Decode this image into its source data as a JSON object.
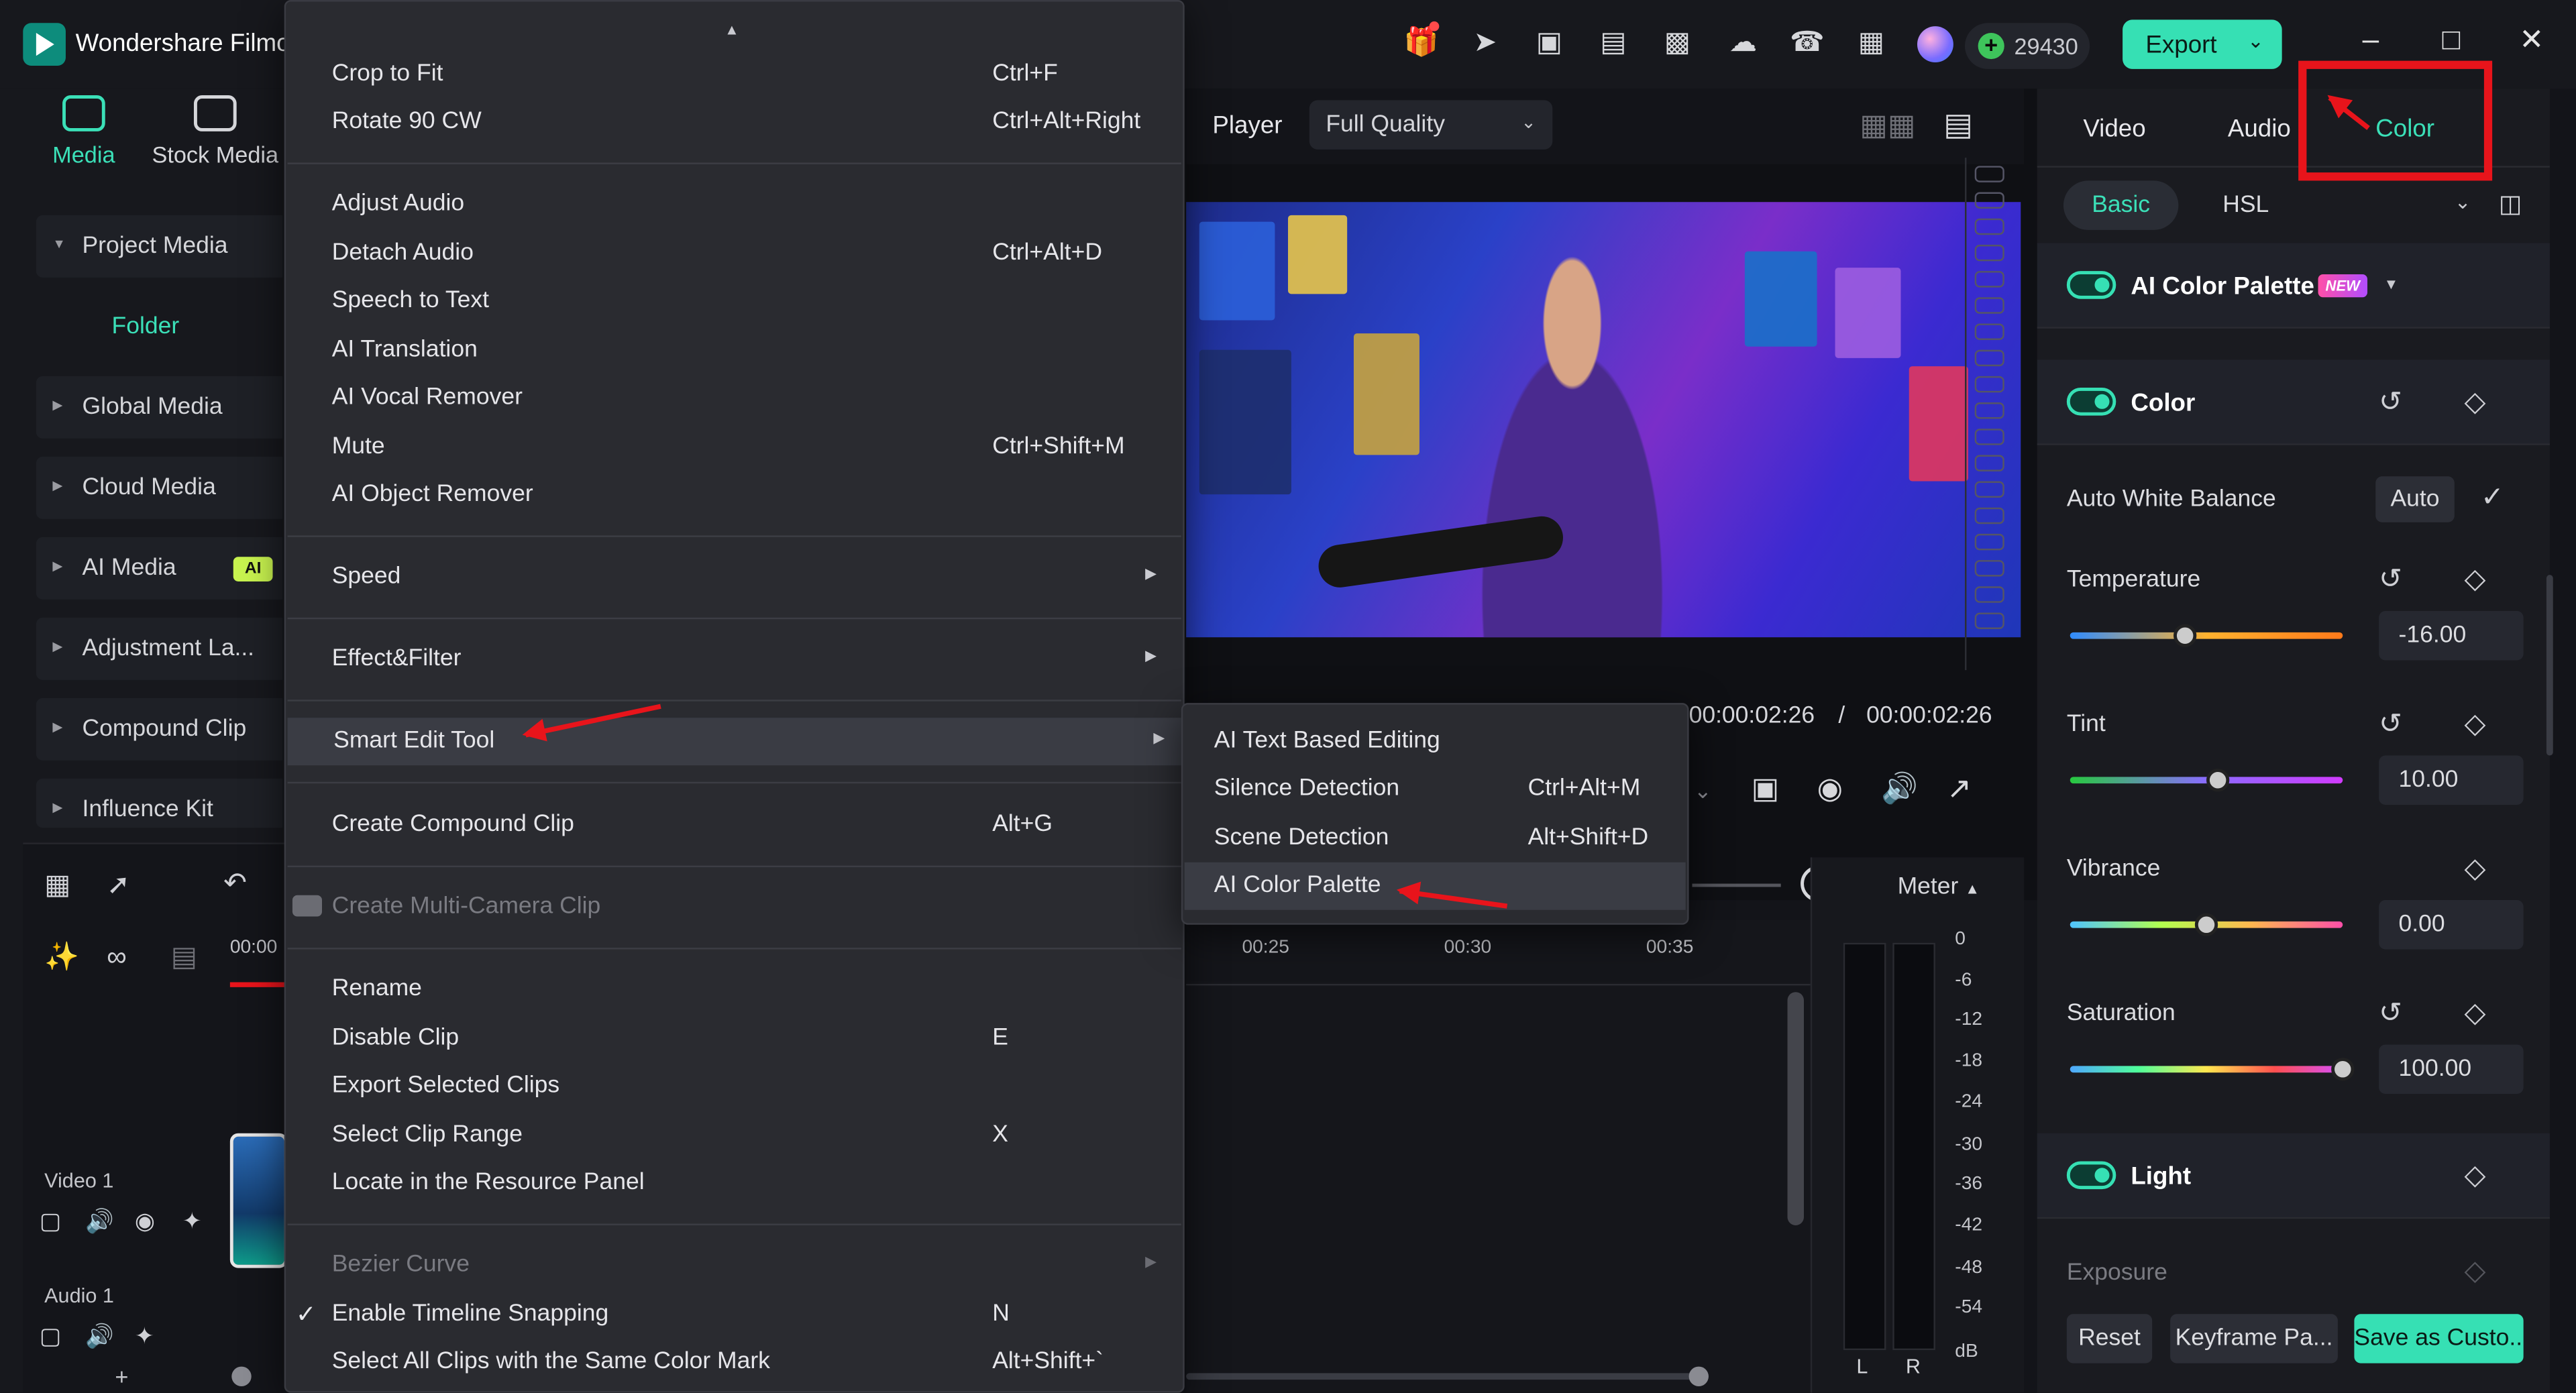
{
  "app": {
    "title": "Wondershare Filmora",
    "credits": "29430",
    "export_label": "Export"
  },
  "media_tabs": [
    {
      "label": "Media",
      "icon": "media-icon",
      "active": true
    },
    {
      "label": "Stock Media",
      "icon": "stock-media-icon",
      "active": false
    }
  ],
  "media_tree": {
    "project_media": "Project Media",
    "folder": "Folder",
    "items": [
      "Global Media",
      "Cloud Media",
      "AI Media",
      "Adjustment La...",
      "Compound Clip",
      "Influence Kit"
    ],
    "ai_badge": "AI"
  },
  "tracks": {
    "video": "Video 1",
    "audio": "Audio 1",
    "ruler_start": "00:00"
  },
  "player": {
    "label": "Player",
    "quality": "Full Quality",
    "current_time": "00:00:02:26",
    "separator": "/",
    "total_time": "00:00:02:26"
  },
  "timeline": {
    "ticks": [
      "00:25",
      "00:30",
      "00:35"
    ]
  },
  "meter": {
    "label": "Meter",
    "db_scale": [
      "0",
      "-6",
      "-12",
      "-18",
      "-24",
      "-30",
      "-36",
      "-42",
      "-48",
      "-54",
      "dB"
    ],
    "left": "L",
    "right": "R"
  },
  "context_menu": {
    "items": [
      {
        "label": "Crop to Fit",
        "shortcut": "Ctrl+F"
      },
      {
        "label": "Rotate 90 CW",
        "shortcut": "Ctrl+Alt+Right"
      },
      {
        "label": "Adjust Audio",
        "shortcut": ""
      },
      {
        "label": "Detach Audio",
        "shortcut": "Ctrl+Alt+D"
      },
      {
        "label": "Speech to Text",
        "shortcut": ""
      },
      {
        "label": "AI Translation",
        "shortcut": ""
      },
      {
        "label": "AI Vocal Remover",
        "shortcut": ""
      },
      {
        "label": "Mute",
        "shortcut": "Ctrl+Shift+M"
      },
      {
        "label": "AI Object Remover",
        "shortcut": ""
      },
      {
        "label": "Speed",
        "shortcut": ""
      },
      {
        "label": "Effect&Filter",
        "shortcut": ""
      },
      {
        "label": "Smart Edit Tool",
        "shortcut": ""
      },
      {
        "label": "Create Compound Clip",
        "shortcut": "Alt+G"
      },
      {
        "label": "Create Multi-Camera Clip",
        "shortcut": ""
      },
      {
        "label": "Rename",
        "shortcut": ""
      },
      {
        "label": "Disable Clip",
        "shortcut": "E"
      },
      {
        "label": "Export Selected Clips",
        "shortcut": ""
      },
      {
        "label": "Select Clip Range",
        "shortcut": "X"
      },
      {
        "label": "Locate in the Resource Panel",
        "shortcut": ""
      },
      {
        "label": "Bezier Curve",
        "shortcut": ""
      },
      {
        "label": "Enable Timeline Snapping",
        "shortcut": "N"
      },
      {
        "label": "Select All Clips with the Same Color Mark",
        "shortcut": "Alt+Shift+`"
      }
    ]
  },
  "submenu": {
    "items": [
      {
        "label": "AI Text Based Editing",
        "shortcut": ""
      },
      {
        "label": "Silence Detection",
        "shortcut": "Ctrl+Alt+M"
      },
      {
        "label": "Scene Detection",
        "shortcut": "Alt+Shift+D"
      },
      {
        "label": "AI Color Palette",
        "shortcut": ""
      }
    ]
  },
  "right_panel": {
    "tabs": [
      "Video",
      "Audio",
      "Color"
    ],
    "active_tab": "Color",
    "subtabs": [
      "Basic",
      "HSL"
    ],
    "ai_color_palette": "AI Color Palette",
    "new_badge": "NEW",
    "color_section": "Color",
    "awb_label": "Auto White Balance",
    "auto_label": "Auto",
    "params": [
      {
        "label": "Temperature",
        "value": "-16.00",
        "fraction": 0.42
      },
      {
        "label": "Tint",
        "value": "10.00",
        "fraction": 0.54
      },
      {
        "label": "Vibrance",
        "value": "0.00",
        "fraction": 0.5
      },
      {
        "label": "Saturation",
        "value": "100.00",
        "fraction": 1.0
      }
    ],
    "light_section": "Light",
    "exposure_label": "Exposure",
    "buttons": {
      "reset": "Reset",
      "keyframe": "Keyframe Pa...",
      "save": "Save as Custo..."
    }
  },
  "colors": {
    "accent": "#36e0b4",
    "annotation_red": "#e8141b"
  }
}
